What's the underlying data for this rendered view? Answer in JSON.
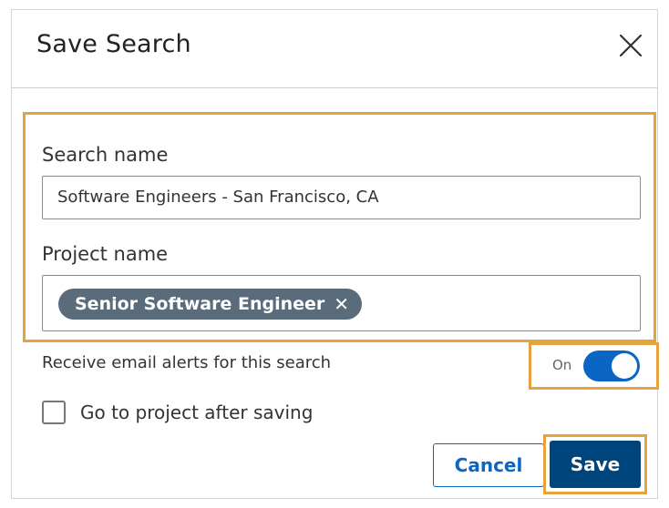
{
  "dialog": {
    "title": "Save Search",
    "close_icon": "close-icon"
  },
  "form": {
    "search_name_label": "Search name",
    "search_name_value": "Software Engineers - San Francisco, CA",
    "project_name_label": "Project name",
    "project_chip_label": "Senior Software Engineer",
    "project_chip_remove": "✕"
  },
  "alerts": {
    "label": "Receive email alerts for this search",
    "toggle_state": "On",
    "toggle_on": true
  },
  "goto_project": {
    "label": "Go to project after saving",
    "checked": false
  },
  "actions": {
    "cancel_label": "Cancel",
    "save_label": "Save"
  },
  "colors": {
    "highlight": "#e6a23c",
    "primary": "#0a66c2",
    "save_bg": "#00447c",
    "chip_bg": "#5a6b7b"
  }
}
